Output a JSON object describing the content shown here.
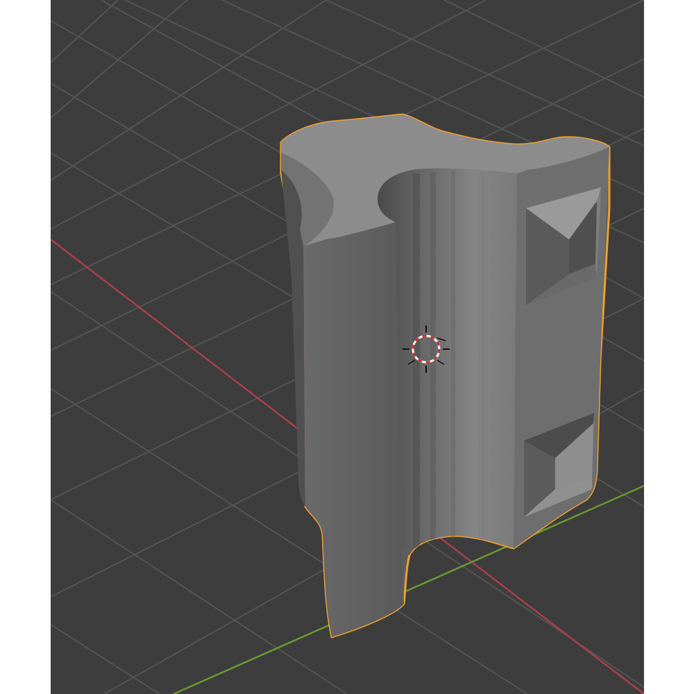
{
  "app": {
    "name": "3D Viewport"
  },
  "scene": {
    "selected_object": "mesh-object",
    "selection_outline_color": "#f0a030",
    "background_color": "#3d3d3d",
    "grid_color": "#555555",
    "x_axis_color": "#b04050",
    "y_axis_color": "#6a9a30",
    "origin_marker": "3d-cursor-icon"
  }
}
